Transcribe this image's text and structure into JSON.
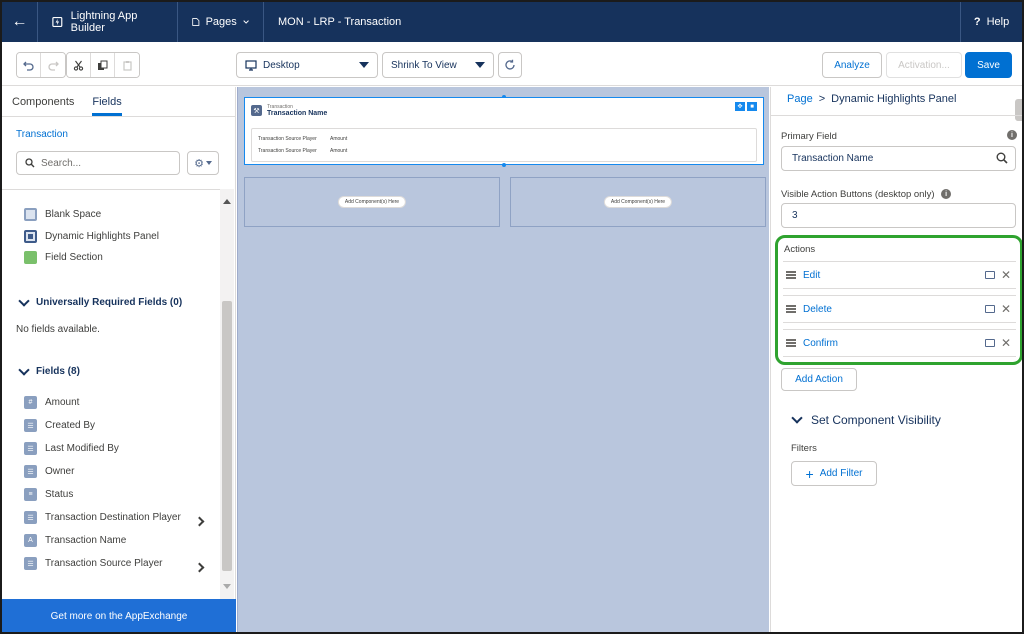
{
  "topbar": {
    "back_icon": "arrow-left-icon",
    "app_name": "Lightning App Builder",
    "pages_label": "Pages",
    "page_title": "MON - LRP - Transaction",
    "help_label": "Help"
  },
  "toolbar": {
    "device": "Desktop",
    "zoom": "Shrink To View",
    "analyze_label": "Analyze",
    "activation_label": "Activation...",
    "save_label": "Save"
  },
  "left": {
    "tabs": [
      "Components",
      "Fields"
    ],
    "active_tab": "Fields",
    "object_link": "Transaction",
    "search_placeholder": "Search...",
    "components": [
      "Blank Space",
      "Dynamic Highlights Panel",
      "Field Section"
    ],
    "required_header": "Universally Required Fields (0)",
    "no_fields": "No fields available.",
    "fields_header": "Fields (8)",
    "fields": [
      "Amount",
      "Created By",
      "Last Modified By",
      "Owner",
      "Status",
      "Transaction Destination Player",
      "Transaction Name",
      "Transaction Source Player"
    ],
    "appexchange": "Get more on the AppExchange"
  },
  "canvas": {
    "object_label": "Transaction",
    "record_name": "Transaction Name",
    "rows": [
      {
        "label": "Transaction Source Player",
        "value": "Amount"
      },
      {
        "label": "Transaction Source Player",
        "value": "Amount"
      }
    ],
    "add_component": "Add Component(s) Here"
  },
  "right": {
    "crumb_page": "Page",
    "crumb_sep": ">",
    "crumb_current": "Dynamic Highlights Panel",
    "primary_field_label": "Primary Field",
    "primary_field_value": "Transaction Name",
    "visible_buttons_label": "Visible Action Buttons (desktop only)",
    "visible_buttons_value": "3",
    "actions_label": "Actions",
    "actions": [
      "Edit",
      "Delete",
      "Confirm"
    ],
    "add_action": "Add Action",
    "visibility_header": "Set Component Visibility",
    "filters_label": "Filters",
    "add_filter": "Add Filter"
  },
  "colors": {
    "nav_bg": "#16325c",
    "brand_blue": "#0070d2",
    "highlight_green": "#2fa32f",
    "canvas_bg": "#b9c6dd"
  }
}
